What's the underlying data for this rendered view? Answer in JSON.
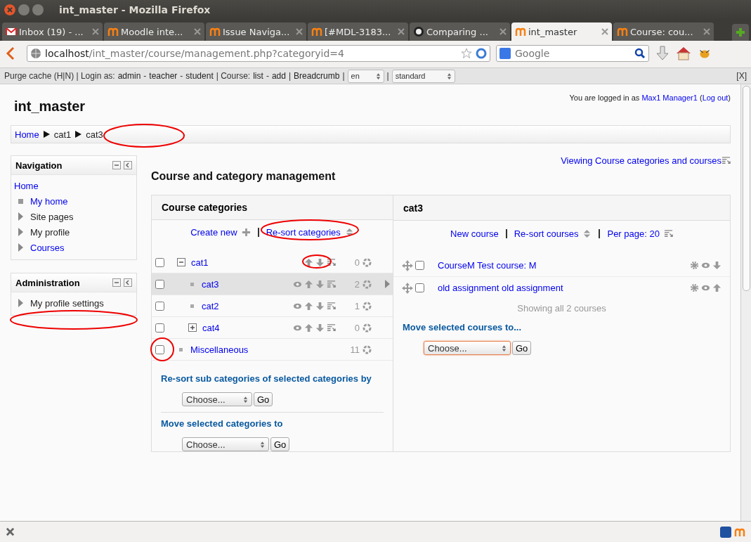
{
  "window": {
    "title": "int_master - Mozilla Firefox"
  },
  "tabs": [
    {
      "label": "Inbox (19) - ...",
      "kind": "mail",
      "selected": false
    },
    {
      "label": "Moodle inte...",
      "kind": "moodle",
      "selected": false
    },
    {
      "label": "Issue Naviga...",
      "kind": "moodle",
      "selected": false
    },
    {
      "label": "[#MDL-3183...",
      "kind": "moodle",
      "selected": false
    },
    {
      "label": "Comparing ...",
      "kind": "github",
      "selected": false
    },
    {
      "label": "int_master",
      "kind": "moodle",
      "selected": true
    },
    {
      "label": "Course: cou...",
      "kind": "moodle",
      "selected": false
    }
  ],
  "address": {
    "host": "localhost",
    "path": "/int_master/course/management.php?categoryid=4"
  },
  "search": {
    "placeholder": "Google"
  },
  "dev_bar": {
    "items": [
      {
        "kind": "text",
        "text": "Purge cache (H|N) | Login as:"
      },
      {
        "kind": "link",
        "text": "admin"
      },
      {
        "kind": "text",
        "text": "-"
      },
      {
        "kind": "link",
        "text": "teacher"
      },
      {
        "kind": "text",
        "text": "-"
      },
      {
        "kind": "link",
        "text": "student"
      },
      {
        "kind": "text",
        "text": "| Course:"
      },
      {
        "kind": "link",
        "text": "list"
      },
      {
        "kind": "text",
        "text": "-"
      },
      {
        "kind": "link",
        "text": "add"
      },
      {
        "kind": "text",
        "text": "|"
      },
      {
        "kind": "link",
        "text": "Breadcrumb"
      },
      {
        "kind": "text",
        "text": "|"
      },
      {
        "kind": "select",
        "text": "en"
      },
      {
        "kind": "text",
        "text": "|"
      },
      {
        "kind": "select",
        "text": "standard"
      }
    ],
    "close": "[X]"
  },
  "site_title": "int_master",
  "login": {
    "prefix": "You are logged in as",
    "user": "Max1 Manager1",
    "open": "(",
    "logout": "Log out",
    "close": ")"
  },
  "breadcrumb": [
    "Home",
    "cat1",
    "cat3"
  ],
  "navigation": {
    "title": "Navigation",
    "items": [
      {
        "label": "Home",
        "kind": "root",
        "link": true
      },
      {
        "label": "My home",
        "kind": "bullet",
        "link": true
      },
      {
        "label": "Site pages",
        "kind": "arrow",
        "link": false
      },
      {
        "label": "My profile",
        "kind": "arrow",
        "link": false
      },
      {
        "label": "Courses",
        "kind": "arrow",
        "link": true
      }
    ]
  },
  "administration": {
    "title": "Administration",
    "items": [
      {
        "label": "My profile settings",
        "kind": "arrow",
        "link": false
      }
    ]
  },
  "view_link": "Viewing Course categories and courses",
  "heading": "Course and category management",
  "categories": {
    "title": "Course categories",
    "create": "Create new",
    "resort": "Re-sort categories",
    "rows": [
      {
        "name": "cat1",
        "kind": "expanded",
        "checked": false,
        "selected": false,
        "eye": false,
        "move": true,
        "count": "0",
        "children": [
          {
            "name": "cat3",
            "kind": "leaf",
            "checked": false,
            "selected": true,
            "eye": true,
            "move": true,
            "count": "2"
          },
          {
            "name": "cat2",
            "kind": "leaf",
            "checked": false,
            "selected": false,
            "eye": true,
            "move": true,
            "count": "1"
          },
          {
            "name": "cat4",
            "kind": "collapsed",
            "checked": false,
            "selected": false,
            "eye": true,
            "move": true,
            "count": "0"
          }
        ]
      },
      {
        "name": "Miscellaneous",
        "kind": "leaf",
        "checked": false,
        "selected": false,
        "eye": false,
        "move": false,
        "count": "11"
      }
    ],
    "resort_label": "Re-sort sub categories of selected categories by",
    "resort_select": "Choose...",
    "resort_go": "Go",
    "move_label": "Move selected categories to",
    "move_select": "Choose...",
    "move_go": "Go"
  },
  "courses": {
    "title": "cat3",
    "new": "New course",
    "resort": "Re-sort courses",
    "per_page": "Per page: 20",
    "rows": [
      {
        "name": "CourseM Test course: M",
        "checked": false,
        "move_up": false,
        "move_down": true
      },
      {
        "name": "old assignment old assignment",
        "checked": false,
        "move_up": true,
        "move_down": false
      }
    ],
    "showing": "Showing all 2 courses",
    "move_label": "Move selected courses to...",
    "move_select": "Choose...",
    "move_select_focused": true,
    "move_go": "Go"
  }
}
